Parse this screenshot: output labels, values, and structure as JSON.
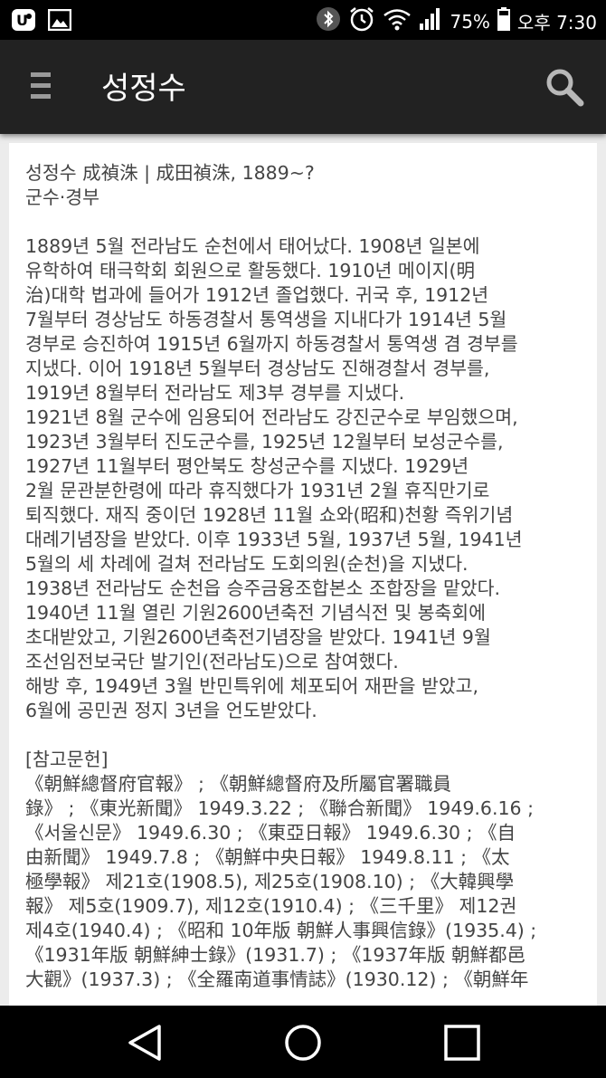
{
  "status_bar": {
    "battery": "75%",
    "time": "오후 7:30",
    "icons": [
      "u-plus-icon",
      "image-icon",
      "bluetooth-icon",
      "alarm-icon",
      "wifi-icon",
      "signal-icon",
      "battery-icon"
    ]
  },
  "app_bar": {
    "title": "성정수",
    "menu_icon": "menu-icon",
    "search_icon": "search-icon"
  },
  "article": {
    "header_lines": [
      "성정수 成禎洙 | 成田禎洙, 1889~?",
      "군수·경부"
    ],
    "body_lines": [
      "1889년 5월 전라남도 순천에서 태어났다. 1908년 일본에",
      "유학하여 태극학회 회원으로 활동했다. 1910년 메이지(明",
      "治)대학 법과에 들어가 1912년 졸업했다. 귀국 후, 1912년",
      "7월부터 경상남도 하동경찰서 통역생을 지내다가 1914년 5월",
      "경부로 승진하여 1915년 6월까지 하동경찰서 통역생 겸 경부를",
      "지냈다. 이어 1918년 5월부터 경상남도 진해경찰서 경부를,",
      "1919년 8월부터 전라남도 제3부 경부를 지냈다.",
      "1921년 8월 군수에 임용되어 전라남도 강진군수로 부임했으며,",
      "1923년 3월부터 진도군수를, 1925년 12월부터 보성군수를,",
      "1927년 11월부터 평안북도 창성군수를 지냈다. 1929년",
      "2월 문관분한령에 따라 휴직했다가 1931년 2월 휴직만기로",
      "퇴직했다. 재직 중이던 1928년 11월 쇼와(昭和)천황 즉위기념",
      "대례기념장을 받았다. 이후 1933년 5월, 1937년 5월, 1941년",
      "5월의 세 차례에 걸쳐 전라남도 도회의원(순천)을 지냈다.",
      "1938년 전라남도 순천읍 승주금융조합본소 조합장을 맡았다.",
      "1940년 11월 열린 기원2600년축전 기념식전 및 봉축회에",
      "초대받았고, 기원2600년축전기념장을 받았다. 1941년 9월",
      "조선임전보국단 발기인(전라남도)으로 참여했다.",
      "해방 후, 1949년 3월 반민특위에 체포되어 재판을 받았고,",
      "6월에 공민권 정지 3년을 언도받았다."
    ],
    "references_heading": "[참고문헌]",
    "reference_lines": [
      "《朝鮮總督府官報》 ; 《朝鮮總督府及所屬官署職員",
      "錄》 ; 《東光新聞》 1949.3.22 ; 《聯合新聞》 1949.6.16 ;",
      "《서울신문》 1949.6.30 ; 《東亞日報》 1949.6.30 ; 《自",
      "由新聞》 1949.7.8 ; 《朝鮮中央日報》 1949.8.11 ; 《太",
      "極學報》 제21호(1908.5), 제25호(1908.10) ; 《大韓興學",
      "報》 제5호(1909.7), 제12호(1910.4) ; 《三千里》 제12권",
      "제4호(1940.4) ; 《昭和 10年版 朝鮮人事興信錄》(1935.4) ;",
      "《1931年版 朝鮮紳士錄》(1931.7) ; 《1937年版 朝鮮都邑",
      "大觀》(1937.3) ; 《全羅南道事情誌》(1930.12) ; 《朝鮮年"
    ]
  },
  "nav_bar": {
    "buttons": [
      "back-icon",
      "home-icon",
      "recents-icon"
    ]
  }
}
